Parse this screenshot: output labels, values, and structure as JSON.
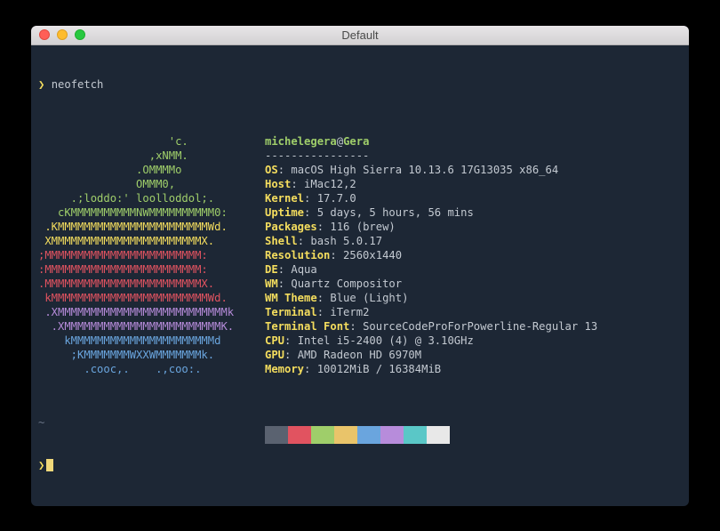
{
  "window": {
    "title": "Default"
  },
  "prompt": {
    "symbol": "❯",
    "command": "neofetch"
  },
  "logo": [
    {
      "text": "                    'c.       ",
      "cls": "green"
    },
    {
      "text": "                 ,xNMM.       ",
      "cls": "green"
    },
    {
      "text": "               .OMMMMo        ",
      "cls": "green"
    },
    {
      "text": "               OMMM0,         ",
      "cls": "green"
    },
    {
      "text": "     .;loddo:' loolloddol;.   ",
      "cls": "green"
    },
    {
      "text": "   cKMMMMMMMMMMNWMMMMMMMMMM0: ",
      "cls": "green"
    },
    {
      "text": " .KMMMMMMMMMMMMMMMMMMMMMMMWd. ",
      "cls": "yellowish"
    },
    {
      "text": " XMMMMMMMMMMMMMMMMMMMMMMMX.   ",
      "cls": "yellowish"
    },
    {
      "text": ";MMMMMMMMMMMMMMMMMMMMMMMM:    ",
      "cls": "red"
    },
    {
      "text": ":MMMMMMMMMMMMMMMMMMMMMMMM:    ",
      "cls": "red"
    },
    {
      "text": ".MMMMMMMMMMMMMMMMMMMMMMMMX.   ",
      "cls": "red"
    },
    {
      "text": " kMMMMMMMMMMMMMMMMMMMMMMMMWd. ",
      "cls": "red"
    },
    {
      "text": " .XMMMMMMMMMMMMMMMMMMMMMMMMMMk",
      "cls": "magenta"
    },
    {
      "text": "  .XMMMMMMMMMMMMMMMMMMMMMMMMK.",
      "cls": "magenta"
    },
    {
      "text": "    kMMMMMMMMMMMMMMMMMMMMMMd  ",
      "cls": "blue"
    },
    {
      "text": "     ;KMMMMMMMWXXWMMMMMMMk.   ",
      "cls": "blue"
    },
    {
      "text": "       .cooc,.    .,coo:.     ",
      "cls": "blue"
    }
  ],
  "header": {
    "user": "michelegera",
    "at": "@",
    "host": "Gera"
  },
  "dashes": "----------------",
  "info": [
    {
      "label": "OS",
      "value": "macOS High Sierra 10.13.6 17G13035 x86_64"
    },
    {
      "label": "Host",
      "value": "iMac12,2"
    },
    {
      "label": "Kernel",
      "value": "17.7.0"
    },
    {
      "label": "Uptime",
      "value": "5 days, 5 hours, 56 mins"
    },
    {
      "label": "Packages",
      "value": "116 (brew)"
    },
    {
      "label": "Shell",
      "value": "bash 5.0.17"
    },
    {
      "label": "Resolution",
      "value": "2560x1440"
    },
    {
      "label": "DE",
      "value": "Aqua"
    },
    {
      "label": "WM",
      "value": "Quartz Compositor"
    },
    {
      "label": "WM Theme",
      "value": "Blue (Light)"
    },
    {
      "label": "Terminal",
      "value": "iTerm2"
    },
    {
      "label": "Terminal Font",
      "value": "SourceCodeProForPowerline-Regular 13"
    },
    {
      "label": "CPU",
      "value": "Intel i5-2400 (4) @ 3.10GHz"
    },
    {
      "label": "GPU",
      "value": "AMD Radeon HD 6970M"
    },
    {
      "label": "Memory",
      "value": "10012MiB / 16384MiB"
    }
  ],
  "swatches": [
    "#5a6270",
    "#e15360",
    "#9fce6a",
    "#e9c46a",
    "#6aa5de",
    "#b78cdb",
    "#5ac7c7",
    "#e8e8e8"
  ],
  "tilde": "~",
  "prompt2": {
    "symbol": "❯"
  }
}
